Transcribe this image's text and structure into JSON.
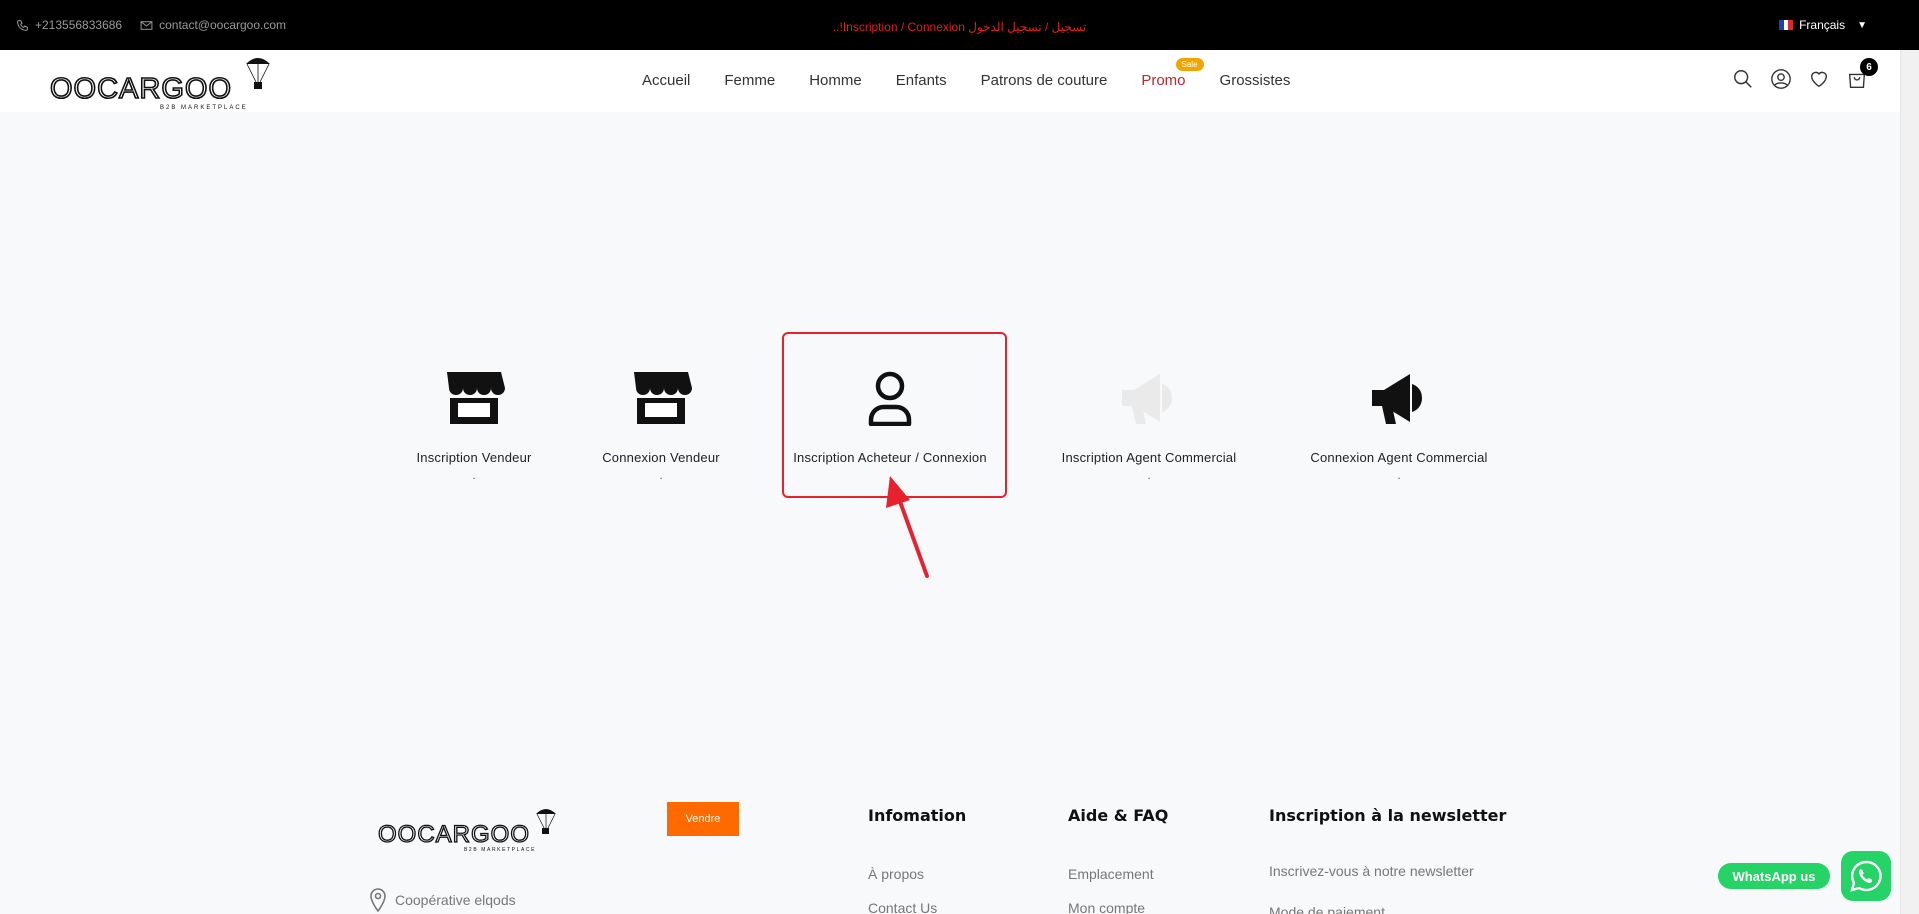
{
  "topbar": {
    "phone": "+213556833686",
    "email": "contact@oocargoo.com",
    "announcement": "..!Inscription / Connexion تسجيل / تسجيل الدخول",
    "language": "Français"
  },
  "brand": {
    "name": "OOCARGOO",
    "tagline": "B2B MARKETPLACE"
  },
  "nav": {
    "items": [
      "Accueil",
      "Femme",
      "Homme",
      "Enfants",
      "Patrons de couture",
      "Promo",
      "Grossistes"
    ],
    "promo_badge": "Sale"
  },
  "header_icons": [
    "search-icon",
    "user-icon",
    "heart-icon",
    "bag-icon"
  ],
  "cart": {
    "count": "6"
  },
  "options": [
    {
      "label": "Inscription Vendeur",
      "dot": ".",
      "icon": "store-icon"
    },
    {
      "label": "Connexion Vendeur",
      "dot": ".",
      "icon": "store-icon"
    },
    {
      "label": "Inscription Acheteur / Connexion",
      "dot": ".",
      "icon": "user-icon"
    },
    {
      "label": "Inscription Agent Commercial",
      "dot": ".",
      "icon": "megaphone-icon"
    },
    {
      "label": "Connexion Agent Commercial",
      "dot": ".",
      "icon": "megaphone-icon"
    }
  ],
  "footer": {
    "vendre": "Vendre",
    "address": "Coopérative elqods",
    "info": {
      "title": "Infomation",
      "links": [
        "À propos",
        "Contact Us"
      ]
    },
    "help": {
      "title": "Aide & FAQ",
      "links": [
        "Emplacement",
        "Mon compte"
      ]
    },
    "newsletter": {
      "title": "Inscription à la newsletter",
      "text": "Inscrivez-vous à notre newsletter",
      "text2": "Mode de paiement"
    }
  },
  "whatsapp": {
    "label": "WhatsApp us"
  },
  "colors": {
    "accent_red": "#e8212e",
    "promo": "#c0262c",
    "vendre": "#ff6a00",
    "whatsapp": "#25d366",
    "sale": "#f0a500"
  }
}
